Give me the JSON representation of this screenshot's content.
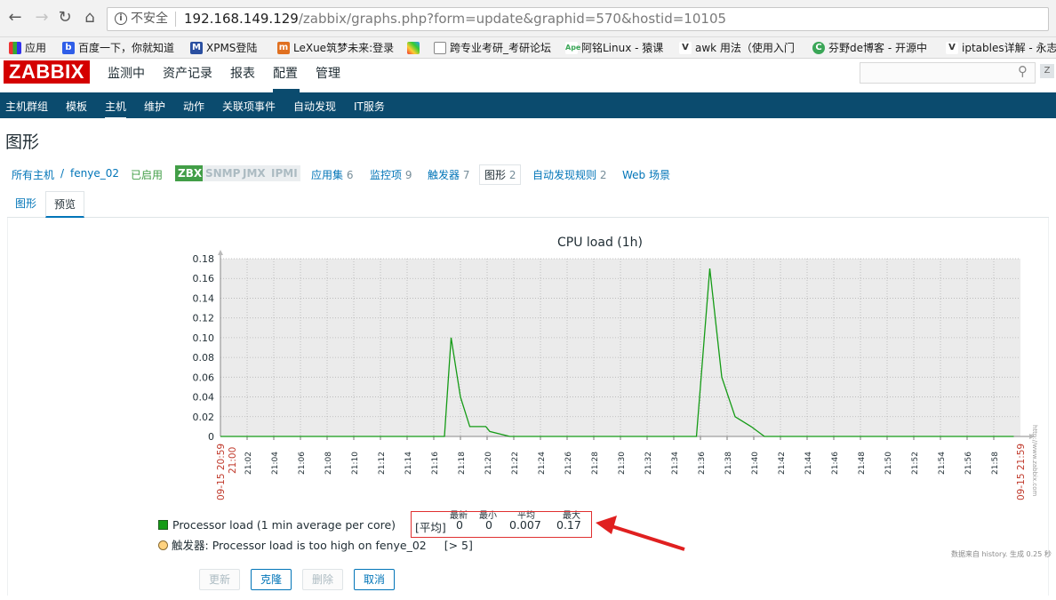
{
  "browser": {
    "insecure_label": "不安全",
    "url_host": "192.168.149.129",
    "url_path": "/zabbix/graphs.php?form=update&graphid=570&hostid=10105",
    "bookmarks": [
      {
        "label": "应用",
        "icon": "apps-grid-icon"
      },
      {
        "label": "百度一下，你就知道",
        "icon": "baidu-paw-icon"
      },
      {
        "label": "XPMS登陆",
        "icon": "xpms-icon"
      },
      {
        "label": "LeXue筑梦未来:登录",
        "icon": "lexue-icon"
      },
      {
        "label": "",
        "icon": "colorful-logo-icon"
      },
      {
        "label": "跨专业考研_考研论坛",
        "icon": "page-icon"
      },
      {
        "label": "阿铭Linux - 猿课",
        "icon": "apeclass-icon"
      },
      {
        "label": "awk 用法（使用入门",
        "icon": "bookmark-v-icon"
      },
      {
        "label": "芬野de博客 - 开源中",
        "icon": "oschina-c-icon"
      },
      {
        "label": "iptables详解 - 永志",
        "icon": "bookmark-v-icon"
      }
    ]
  },
  "header": {
    "logo": "ZABBIX",
    "menu": [
      "监测中",
      "资产记录",
      "报表",
      "配置",
      "管理"
    ],
    "active_menu": "配置"
  },
  "subnav": {
    "items": [
      "主机群组",
      "模板",
      "主机",
      "维护",
      "动作",
      "关联项事件",
      "自动发现",
      "IT服务"
    ],
    "active": "主机"
  },
  "page": {
    "title": "图形"
  },
  "hostnav": {
    "all_hosts": "所有主机",
    "host": "fenye_02",
    "status": "已启用",
    "badges": [
      "ZBX",
      "SNMP",
      "JMX",
      "IPMI"
    ],
    "applications": {
      "label": "应用集",
      "count": "6"
    },
    "items": {
      "label": "监控项",
      "count": "9"
    },
    "triggers": {
      "label": "触发器",
      "count": "7"
    },
    "graphs": {
      "label": "图形",
      "count": "2"
    },
    "discovery": {
      "label": "自动发现规则",
      "count": "2"
    },
    "web": {
      "label": "Web 场景"
    }
  },
  "tabs": [
    {
      "label": "图形"
    },
    {
      "label": "预览"
    }
  ],
  "active_tab": "预览",
  "chart_data": {
    "type": "line",
    "title": "CPU load (1h)",
    "ylim": [
      0,
      0.18
    ],
    "yticks": [
      "0",
      "0.02",
      "0.04",
      "0.06",
      "0.08",
      "0.10",
      "0.12",
      "0.14",
      "0.16",
      "0.18"
    ],
    "xticks": [
      "21:02",
      "21:04",
      "21:06",
      "21:08",
      "21:10",
      "21:12",
      "21:14",
      "21:16",
      "21:18",
      "21:20",
      "21:22",
      "21:24",
      "21:26",
      "21:28",
      "21:30",
      "21:32",
      "21:34",
      "21:36",
      "21:38",
      "21:40",
      "21:42",
      "21:44",
      "21:46",
      "21:48",
      "21:50",
      "21:52",
      "21:54",
      "21:56",
      "21:58"
    ],
    "x_start_label": "09-15 20:59",
    "x_start_time": "21:00",
    "x_end_label": "09-15 21:59",
    "grid": true,
    "series": [
      {
        "name": "Processor load (1 min average per core)",
        "color": "#159B16",
        "x_minutes": [
          0,
          16.8,
          17.3,
          18.0,
          18.7,
          19.9,
          20.2,
          21.7,
          59.5
        ],
        "values": [
          0,
          0,
          0.1,
          0.04,
          0.01,
          0.01,
          0.005,
          0,
          0
        ],
        "x_minutes_2": [
          35.7,
          36.7,
          37.6,
          38.6,
          39.8,
          40.8,
          59.5
        ],
        "values_2": [
          0,
          0.17,
          0.06,
          0.02,
          0.01,
          0,
          0
        ]
      }
    ]
  },
  "legend": {
    "series_label": "Processor load (1 min average per core)",
    "stat_prefix": "[平均]",
    "stat_headers": [
      "最新",
      "最小",
      "平均",
      "最大"
    ],
    "stat_values": [
      "0",
      "0",
      "0.007",
      "0.17"
    ],
    "trigger_prefix": "触发器:",
    "trigger_label": "Processor load is too high on fenye_02",
    "trigger_threshold": "[> 5]",
    "trigger_value": 5,
    "trigger_color": "#FFD27F"
  },
  "note": "数据来自 history. 生成 0.25 秒",
  "vertical_note": "http://www.zabbix.com",
  "buttons": {
    "update": "更新",
    "clone": "克隆",
    "delete": "删除",
    "cancel": "取消"
  }
}
